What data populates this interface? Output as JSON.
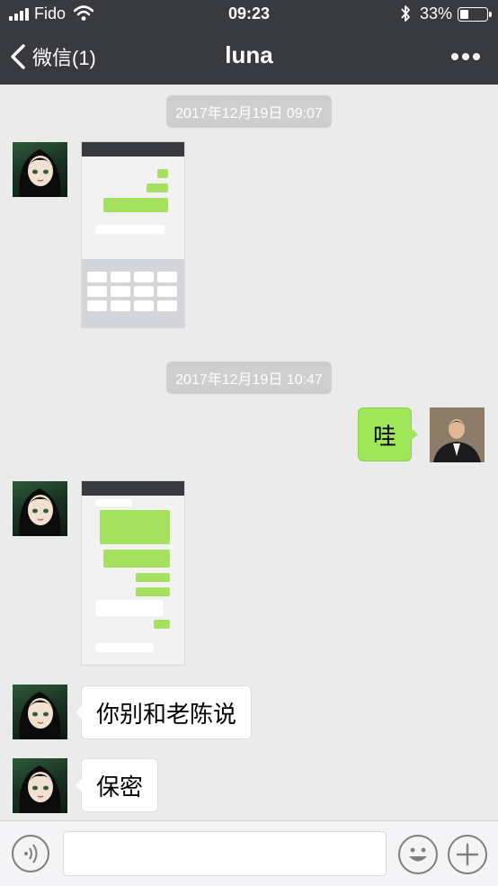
{
  "status_bar": {
    "carrier": "Fido",
    "time": "09:23",
    "battery": "33%"
  },
  "nav": {
    "back_label": "微信(1)",
    "title": "luna"
  },
  "messages": {
    "ts1": "2017年12月19日 09:07",
    "ts2": "2017年12月19日 10:47",
    "wa": "哇",
    "m3": "你别和老陈说",
    "m4": "保密"
  },
  "colors": {
    "nav_bg": "#393a3f",
    "chat_bg": "#ebebeb",
    "sent_bubble": "#9fe658",
    "received_bubble": "#ffffff"
  },
  "icons": {
    "back": "chevron-left-icon",
    "more": "more-icon",
    "voice": "voice-icon",
    "emoji": "emoji-icon",
    "add": "plus-icon"
  }
}
